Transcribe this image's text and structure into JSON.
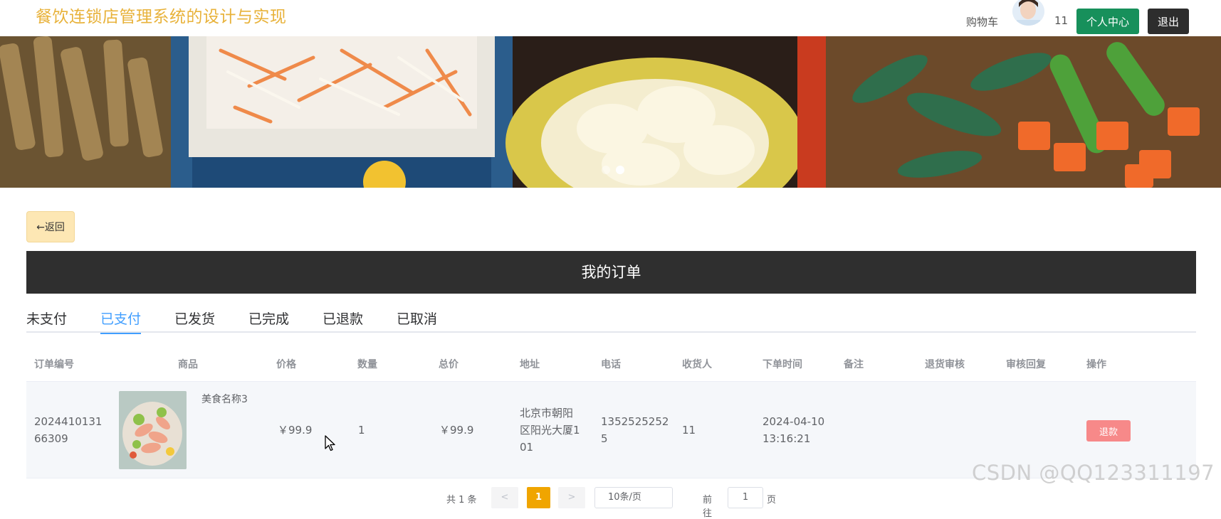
{
  "header": {
    "site_title": "餐饮连锁店管理系统的设计与实现",
    "cart_label": "购物车",
    "user_name": "11",
    "center_label": "个人中心",
    "logout_label": "退出"
  },
  "back_label": "←返回",
  "orders_title": "我的订单",
  "tabs": [
    {
      "label": "未支付",
      "active": false
    },
    {
      "label": "已支付",
      "active": true
    },
    {
      "label": "已发货",
      "active": false
    },
    {
      "label": "已完成",
      "active": false
    },
    {
      "label": "已退款",
      "active": false
    },
    {
      "label": "已取消",
      "active": false
    }
  ],
  "table": {
    "columns": [
      "订单编号",
      "商品",
      "价格",
      "数量",
      "总价",
      "地址",
      "电话",
      "收货人",
      "下单时间",
      "备注",
      "退货审核",
      "审核回复",
      "操作"
    ],
    "rows": [
      {
        "order_no_1": "2024410131",
        "order_no_2": "66309",
        "product_name": "美食名称3",
        "price": "￥99.9",
        "quantity": "1",
        "total": "￥99.9",
        "address_1": "北京市朝阳",
        "address_2": "区阳光大厦1",
        "address_3": "01",
        "phone_1": "1352525252",
        "phone_2": "5",
        "receiver": "11",
        "time_1": "2024-04-10",
        "time_2": "13:16:21",
        "remark": "",
        "return_review": "",
        "review_reply": "",
        "action_label": "退款"
      }
    ]
  },
  "pagination": {
    "total": "共 1 条",
    "prev": "<",
    "current": "1",
    "next": ">",
    "page_size": "10条/页",
    "goto_label": "前往",
    "goto_value": "1",
    "page_suffix": "页"
  },
  "watermark": "CSDN @QQ123311197",
  "colors": {
    "title": "#e8b23a",
    "center_button": "#17905b",
    "logout_button": "#2d2d2d",
    "header_bar": "#2f2f2f",
    "active_tab": "#409eff",
    "refund_button": "#f78989",
    "back_button": "#fde7b4",
    "current_page": "#f0a500"
  },
  "icons": {
    "carousel_dots": 2,
    "avatar": "user-avatar-image",
    "cursor": "mouse-pointer-icon"
  }
}
